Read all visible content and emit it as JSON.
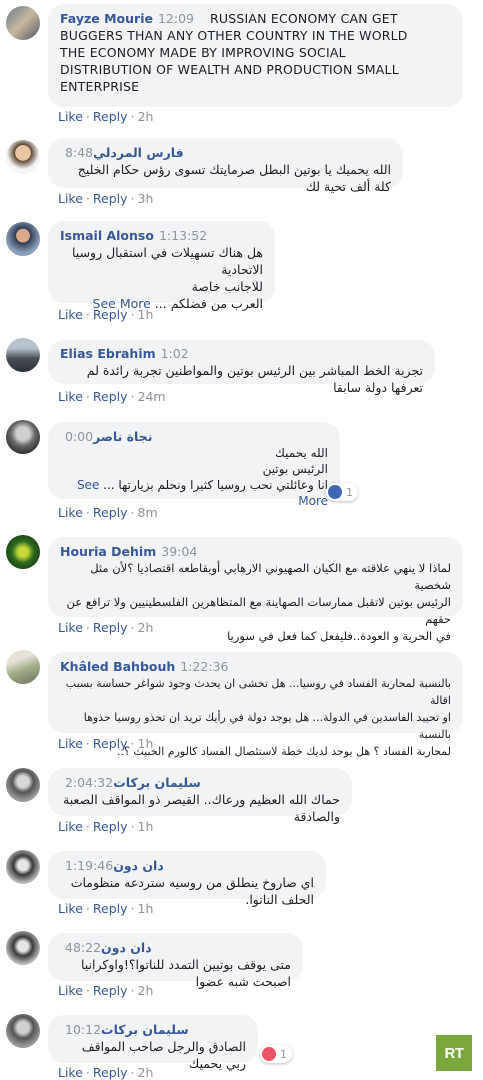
{
  "comments": [
    {
      "author": "Fayze Mourie",
      "time": "12:09",
      "lines": [
        "RUSSIAN ECONOMY CAN GET",
        "BUGGERS THAN ANY OTHER COUNTRY IN THE WORLD",
        "THE ECONOMY MADE BY IMPROVING SOCIAL",
        "DISTRIBUTION OF WEALTH AND PRODUCTION SMALL",
        "ENTERPRISE"
      ],
      "like": "Like",
      "reply": "Reply",
      "age": "2h"
    },
    {
      "author": "فارس المردلي",
      "time": "8:48",
      "lines": [
        "الله يحميك يا بوتين البطل صرمايتك تسوى رؤس حكام الخليج كلة ألف تحية لك"
      ],
      "like": "Like",
      "reply": "Reply",
      "age": "3h"
    },
    {
      "author": "Ismail Alonso",
      "time": "1:13:52",
      "lines": [
        "هل هناك تسهيلات في استقبال روسيا الاتحادية",
        "للاجانب خاصة",
        "العرب من فضلكم ..."
      ],
      "see_more": "See More",
      "like": "Like",
      "reply": "Reply",
      "age": "1h"
    },
    {
      "author": "Elias Ebrahim",
      "time": "1:02",
      "lines": [
        "تجربة الخط المباشر بين الرئيس بوتين والمواطنين تجربة رائدة لم تعرفها دولة سابقا"
      ],
      "like": "Like",
      "reply": "Reply",
      "age": "24m"
    },
    {
      "author": "نجاة ناصر",
      "time": "0:00",
      "lines": [
        "الله يحميك",
        "الرئيس بوتين",
        "انا وعائلتي نحب روسيا كثيرا ونحلم بزيارتها ..."
      ],
      "see_more": "See More",
      "reaction_count": "1",
      "like": "Like",
      "reply": "Reply",
      "age": "8m"
    },
    {
      "author": "Houria Dehim",
      "time": "39:04",
      "lines": [
        "لماذا لا ينهي علاقته مع الكيان الصهيوني الارهابي أويقاطعه اقتصاديا ؟لأن مثل شخصية",
        "الرئيس بوتين لاتقبل ممارسات الصهاينة مع المتظاهرين الفلسطينيين ولا ترافع عن حقهم",
        "في الحرية و العودة..فليفعل كما فعل في سوريا"
      ],
      "like": "Like",
      "reply": "Reply",
      "age": "2h"
    },
    {
      "author": "Khâled Bahbouh",
      "time": "1:22:36",
      "lines": [
        "بالنسبة لمحاربة الفساد في روسيا... هل تخشى ان يحدث وجود شواغر حساسة بسبب اقالة",
        "او تحييد الفاسدين في الدولة... هل يوجد دولة في رأيك تريد ان تحذو روسيا حذوها بالنسبة",
        "لمحاربة الفساد ؟ هل يوجد لديك خطة لاستئصال الفساد كالورم الخبيث ؟.."
      ],
      "like": "Like",
      "reply": "Reply",
      "age": "1h"
    },
    {
      "author": "سليمان بركات",
      "time": "2:04:32",
      "lines": [
        "حماك الله العظيم ورعاك.. القيصر ذو المواقف الصعبة والصادقة"
      ],
      "like": "Like",
      "reply": "Reply",
      "age": "1h"
    },
    {
      "author": "دان دون",
      "time": "1:19:46",
      "lines": [
        "اي صاروخ ينطلق من روسيه ستردعه منظومات الحلف الناتوا."
      ],
      "like": "Like",
      "reply": "Reply",
      "age": "1h"
    },
    {
      "author": "دان دون",
      "time": "48:22",
      "lines": [
        "متى يوقف بوتيين التمدد للناتوا؟!واوكرانيا اصبحت شبه عضوا"
      ],
      "like": "Like",
      "reply": "Reply",
      "age": "2h"
    },
    {
      "author": "سليمان بركات",
      "time": "10:12",
      "lines": [
        "الصادق والرجل صاحب المواقف ربي يحميك"
      ],
      "reaction_count": "1",
      "like": "Like",
      "reply": "Reply",
      "age": "2h"
    }
  ],
  "watermark": "RT",
  "colors": {
    "link": "#385898",
    "bubble": "#f2f3f5",
    "meta": "#90949c",
    "rt_green": "#7aa83b"
  }
}
